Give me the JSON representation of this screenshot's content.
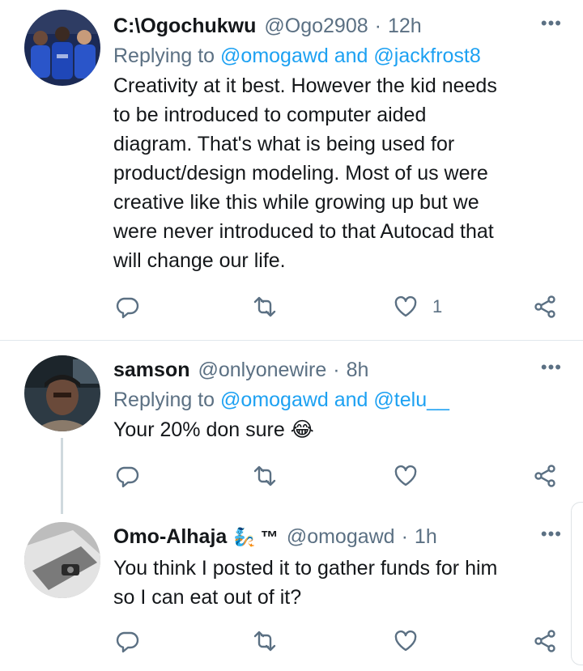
{
  "tweets": [
    {
      "name": "C:\\Ogochukwu",
      "handle": "@Ogo2908",
      "time": "12h",
      "replying_prefix": "Replying to",
      "replying_mentions": "@omogawd and @jackfrost8",
      "text_lines": [
        "Creativity at it best. However the kid needs",
        "to be introduced to computer aided",
        "diagram. That's what is being used for",
        "product/design modeling. Most of us were",
        "creative like this while growing up but we",
        "were never introduced to that Autocad that",
        "will change our life."
      ],
      "like_count": "1"
    },
    {
      "name": "samson",
      "handle": "@onlyonewire",
      "time": "8h",
      "replying_prefix": "Replying to",
      "replying_mentions": "@omogawd and @telu__",
      "text_lines": [
        "Your 20% don sure 😂"
      ],
      "like_count": ""
    },
    {
      "name": "Omo-Alhaja",
      "name_suffix": "🧞 ™",
      "handle": "@omogawd",
      "time": "1h",
      "text_lines": [
        "You think I posted it to gather funds for him",
        "so I can eat out of it?"
      ],
      "like_count": ""
    }
  ],
  "separator": "·",
  "more_glyph": "•••",
  "colors": {
    "accent": "#1da1f2",
    "muted": "#5b7083",
    "text": "#14171a"
  },
  "icons": [
    "reply-icon",
    "retweet-icon",
    "like-icon",
    "share-icon",
    "more-icon"
  ]
}
